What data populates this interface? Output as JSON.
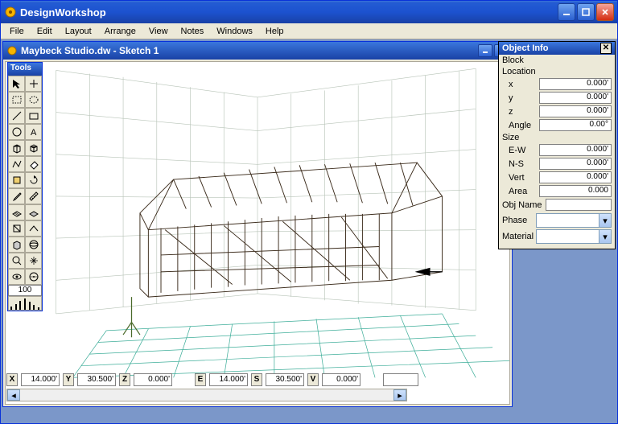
{
  "app": {
    "title": "DesignWorkshop",
    "menus": [
      "File",
      "Edit",
      "Layout",
      "Arrange",
      "View",
      "Notes",
      "Windows",
      "Help"
    ]
  },
  "document": {
    "title": "Maybeck Studio.dw - Sketch 1"
  },
  "tools": {
    "title": "Tools",
    "readout": "100"
  },
  "coords": {
    "X": "14.000'",
    "Y": "30.500'",
    "Z": "0.000'",
    "E": "14.000'",
    "S": "30.500'",
    "V": "0.000'"
  },
  "object_info": {
    "title": "Object Info",
    "kind": "Block",
    "sections": {
      "location_label": "Location",
      "size_label": "Size"
    },
    "location": {
      "x_label": "x",
      "x": "0.000'",
      "y_label": "y",
      "y": "0.000'",
      "z_label": "z",
      "z": "0.000'",
      "angle_label": "Angle",
      "angle": "0.00°"
    },
    "size": {
      "ew_label": "E-W",
      "ew": "0.000'",
      "ns_label": "N-S",
      "ns": "0.000'",
      "vert_label": "Vert",
      "vert": "0.000'",
      "area_label": "Area",
      "area": "0.000"
    },
    "obj_name_label": "Obj Name",
    "obj_name": "",
    "phase_label": "Phase",
    "phase": "",
    "material_label": "Material",
    "material": ""
  }
}
